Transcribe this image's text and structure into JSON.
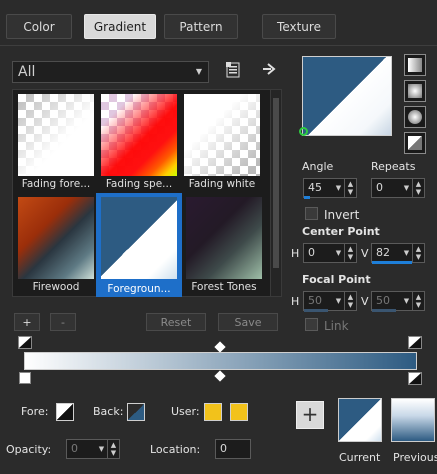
{
  "tabs": [
    {
      "label": "Color"
    },
    {
      "label": "Gradient"
    },
    {
      "label": "Pattern"
    },
    {
      "label": "Texture"
    }
  ],
  "filter": {
    "selected": "All"
  },
  "gradients": [
    {
      "name": "Fading fore...",
      "style": "fading-fore"
    },
    {
      "name": "Fading spe...",
      "style": "fading-spectrum"
    },
    {
      "name": "Fading white",
      "style": "fading-white"
    },
    {
      "name": "Firewood",
      "style": "firewood"
    },
    {
      "name": "Foregroun...",
      "style": "foreground",
      "selected": true
    },
    {
      "name": "Forest Tones",
      "style": "forest"
    }
  ],
  "actions": {
    "add": "+",
    "remove": "-",
    "reset": "Reset",
    "save": "Save"
  },
  "angle": {
    "label": "Angle",
    "value": "45"
  },
  "repeats": {
    "label": "Repeats",
    "value": "0"
  },
  "invert": {
    "label": "Invert",
    "checked": false
  },
  "center_point": {
    "label": "Center Point",
    "h_label": "H",
    "h_value": "0",
    "v_label": "V",
    "v_value": "82"
  },
  "focal_point": {
    "label": "Focal Point",
    "h_label": "H",
    "h_value": "50",
    "v_label": "V",
    "v_value": "50"
  },
  "link": {
    "label": "Link"
  },
  "fore": {
    "label": "Fore:"
  },
  "back": {
    "label": "Back:"
  },
  "user": {
    "label": "User:",
    "color1": "#f2c21b",
    "color2": "#f2c21b"
  },
  "opacity": {
    "label": "Opacity:",
    "value": "0"
  },
  "location": {
    "label": "Location:",
    "value": "0"
  },
  "current_label": "Current",
  "previous_label": "Previous",
  "colors": {
    "accent": "#1e7fd9",
    "gradient_dark": "#2d5b82"
  }
}
